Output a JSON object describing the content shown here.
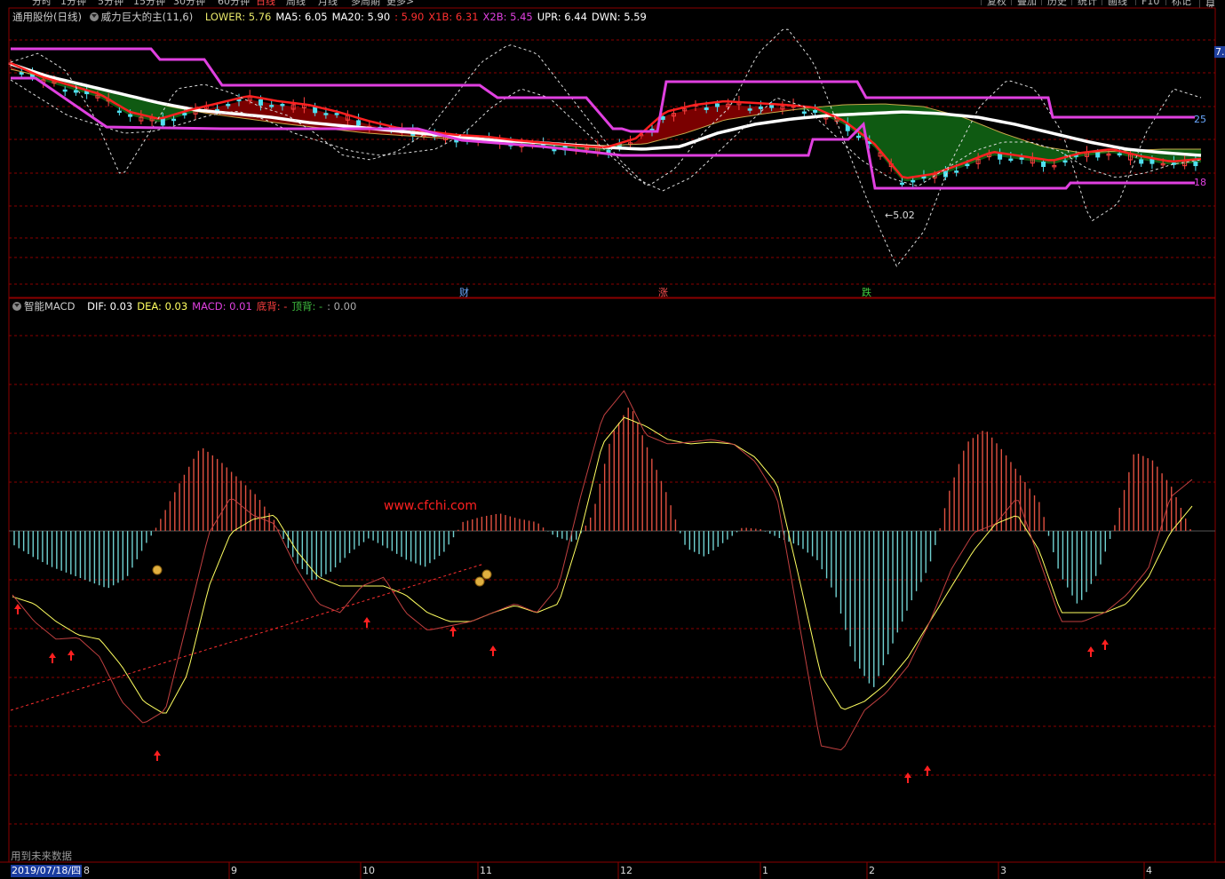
{
  "periods": [
    "分时",
    "1分钟",
    "5分钟",
    "15分钟",
    "30分钟",
    "60分钟",
    "日线",
    "周线",
    "月线",
    "多周期",
    "更多>"
  ],
  "toolbar": [
    "复权",
    "叠加",
    "历史",
    "统计",
    "画线",
    "F10",
    "标记",
    "自选"
  ],
  "main_legend": {
    "stock": "通用股份(日线)",
    "indicator": "威力巨大的主(11,6)",
    "items": [
      {
        "label": "LOWER: 5.76",
        "color": "#e8e86a"
      },
      {
        "label": "MA5: 6.05",
        "color": "#ffffff"
      },
      {
        "label": "MA20: 5.90",
        "color": "#ffffff"
      },
      {
        "label": ": 5.90",
        "color": "#ff3030"
      },
      {
        "label": "X1B: 6.31",
        "color": "#ff3030"
      },
      {
        "label": "X2B: 5.45",
        "color": "#e040e0"
      },
      {
        "label": "UPR: 6.44",
        "color": "#ffffff"
      },
      {
        "label": "DWN: 5.59",
        "color": "#ffffff"
      }
    ]
  },
  "macd_legend": {
    "name": "智能MACD",
    "items": [
      {
        "label": "DIF: 0.03",
        "color": "#ffffff"
      },
      {
        "label": "DEA: 0.03",
        "color": "#ffff60"
      },
      {
        "label": "MACD: 0.01",
        "color": "#e040e0"
      },
      {
        "label": "底背: -",
        "color": "#ff4040"
      },
      {
        "label": "顶背: -",
        "color": "#40c040"
      },
      {
        "label": ": 0.00",
        "color": "#aaaaaa"
      }
    ]
  },
  "labels": {
    "low_price": "5.02",
    "pink_upper": "25",
    "pink_lower": "18",
    "right_edge": "7.",
    "watermark": "www.cfchi.com",
    "future_note": "用到未来数据",
    "date": "2019/07/18/四",
    "date_prefix": "2"
  },
  "markers": [
    {
      "text": "财",
      "color": "#6aa8ff"
    },
    {
      "text": "涨",
      "color": "#ff5050"
    },
    {
      "text": "跌",
      "color": "#40d040"
    }
  ],
  "x_axis": [
    "8",
    "9",
    "10",
    "11",
    "12",
    "1",
    "2",
    "3",
    "4"
  ],
  "colors": {
    "frame": "#8b0000",
    "pink": "#e040e0",
    "dif": "#ffffff",
    "dea": "#ffff60",
    "bar_pos": "#e05040",
    "bar_neg": "#70d0d0"
  },
  "chart_data": {
    "type": "line",
    "title": "智能MACD",
    "series": [
      {
        "name": "MACD",
        "values": [
          -0.1,
          -0.18,
          -0.25,
          -0.3,
          -0.35,
          -0.4,
          -0.33,
          -0.1,
          0.1,
          0.3,
          0.48,
          0.4,
          0.3,
          0.2,
          0.05,
          -0.2,
          -0.35,
          -0.28,
          -0.15,
          -0.05,
          -0.12,
          -0.2,
          -0.25,
          -0.15,
          0.05,
          0.08,
          0.1,
          0.07,
          0.05,
          -0.04,
          -0.08,
          0.1,
          0.55,
          0.72,
          0.45,
          0.2,
          -0.12,
          -0.18,
          -0.08,
          0.02,
          0.01,
          -0.05,
          -0.1,
          -0.2,
          -0.45,
          -0.9,
          -1.1,
          -0.8,
          -0.5,
          -0.25,
          0.2,
          0.5,
          0.58,
          0.45,
          0.3,
          0.15,
          -0.3,
          -0.52,
          -0.3,
          0.05,
          0.45,
          0.4,
          0.25,
          0.01
        ]
      }
    ]
  }
}
